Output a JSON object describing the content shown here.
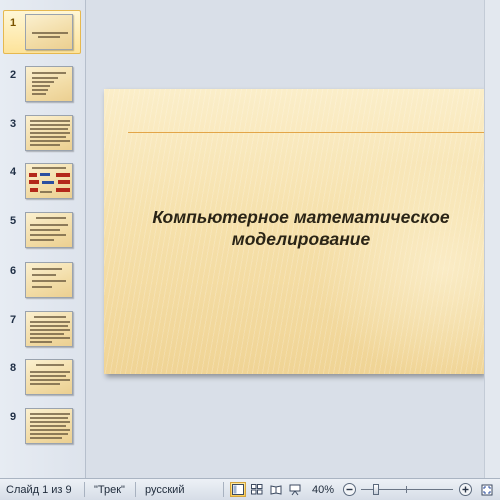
{
  "thumbnails": [
    {
      "number": "1",
      "selected": true
    },
    {
      "number": "2",
      "selected": false
    },
    {
      "number": "3",
      "selected": false
    },
    {
      "number": "4",
      "selected": false
    },
    {
      "number": "5",
      "selected": false
    },
    {
      "number": "6",
      "selected": false
    },
    {
      "number": "7",
      "selected": false
    },
    {
      "number": "8",
      "selected": false
    },
    {
      "number": "9",
      "selected": false
    }
  ],
  "slide": {
    "title_line1": "Компьютерное математическое",
    "title_line2": "моделирование"
  },
  "statusbar": {
    "slide_info": "Слайд 1 из 9",
    "theme": "\"Трек\"",
    "language": "русский",
    "zoom": "40%",
    "zoom_level": 40
  },
  "views": [
    {
      "name": "normal-view",
      "active": true
    },
    {
      "name": "slide-sorter-view",
      "active": false
    },
    {
      "name": "reading-view",
      "active": false
    },
    {
      "name": "slide-show-view",
      "active": false
    }
  ],
  "colors": {
    "accent": "#f9cd5a",
    "slide_rule": "#e3a548",
    "slide_bg": "#f6e1ac"
  }
}
